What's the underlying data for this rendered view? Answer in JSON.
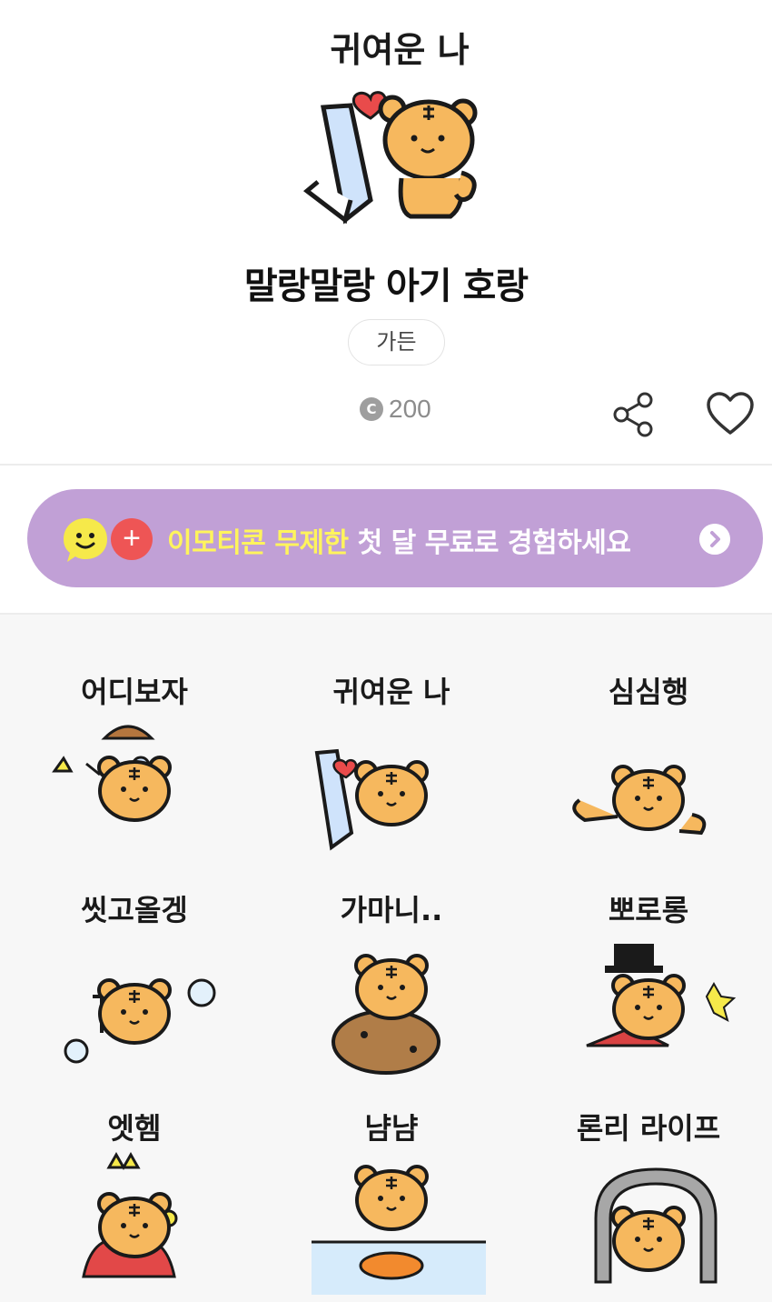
{
  "pack": {
    "main_caption": "귀여운 나",
    "title": "말랑말랑 아기 호랑",
    "author": "가든",
    "price": "200",
    "coin_symbol": "C"
  },
  "actions": {
    "share_icon": "share-icon",
    "like_icon": "heart-outline-icon"
  },
  "promo": {
    "highlight": "이모티콘 무제한",
    "rest": " 첫 달 무료로 경험하세요",
    "plus": "+",
    "bg_color": "#c1a0d6",
    "highlight_color": "#fff45c"
  },
  "stickers": [
    {
      "caption": "어디보자"
    },
    {
      "caption": "귀여운 나"
    },
    {
      "caption": "심심행"
    },
    {
      "caption": "씻고올겡"
    },
    {
      "caption": "가마니.."
    },
    {
      "caption": "뽀로롱"
    },
    {
      "caption": "엣헴"
    },
    {
      "caption": "냠냠"
    },
    {
      "caption": "론리 라이프"
    }
  ],
  "colors": {
    "tiger": "#f6b85e",
    "outline": "#1a1a1a",
    "grid_bg": "#f7f7f7"
  }
}
